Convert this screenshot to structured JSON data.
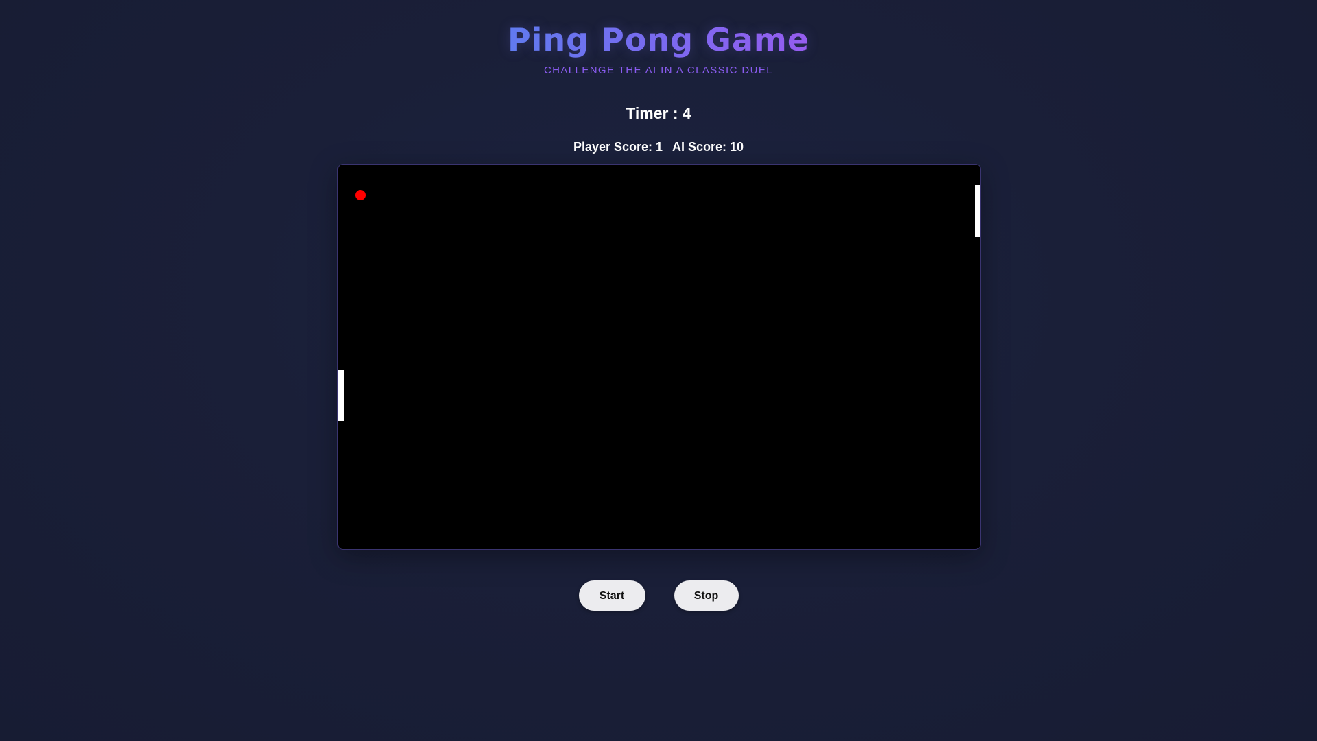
{
  "header": {
    "title": "Ping Pong Game",
    "subtitle": "CHALLENGE THE AI IN A CLASSIC DUEL"
  },
  "timer": {
    "label": "Timer : 4"
  },
  "scores": {
    "player": "Player Score: 1",
    "ai": "AI Score: 10"
  },
  "controls": {
    "start_label": "Start",
    "stop_label": "Stop"
  },
  "colors": {
    "ball": "#ff0000",
    "paddle": "#ffffff",
    "board": "#000000",
    "title_gradient_start": "#5f7df0",
    "title_gradient_end": "#9a5cf0",
    "subtitle": "#8a5cf0"
  }
}
